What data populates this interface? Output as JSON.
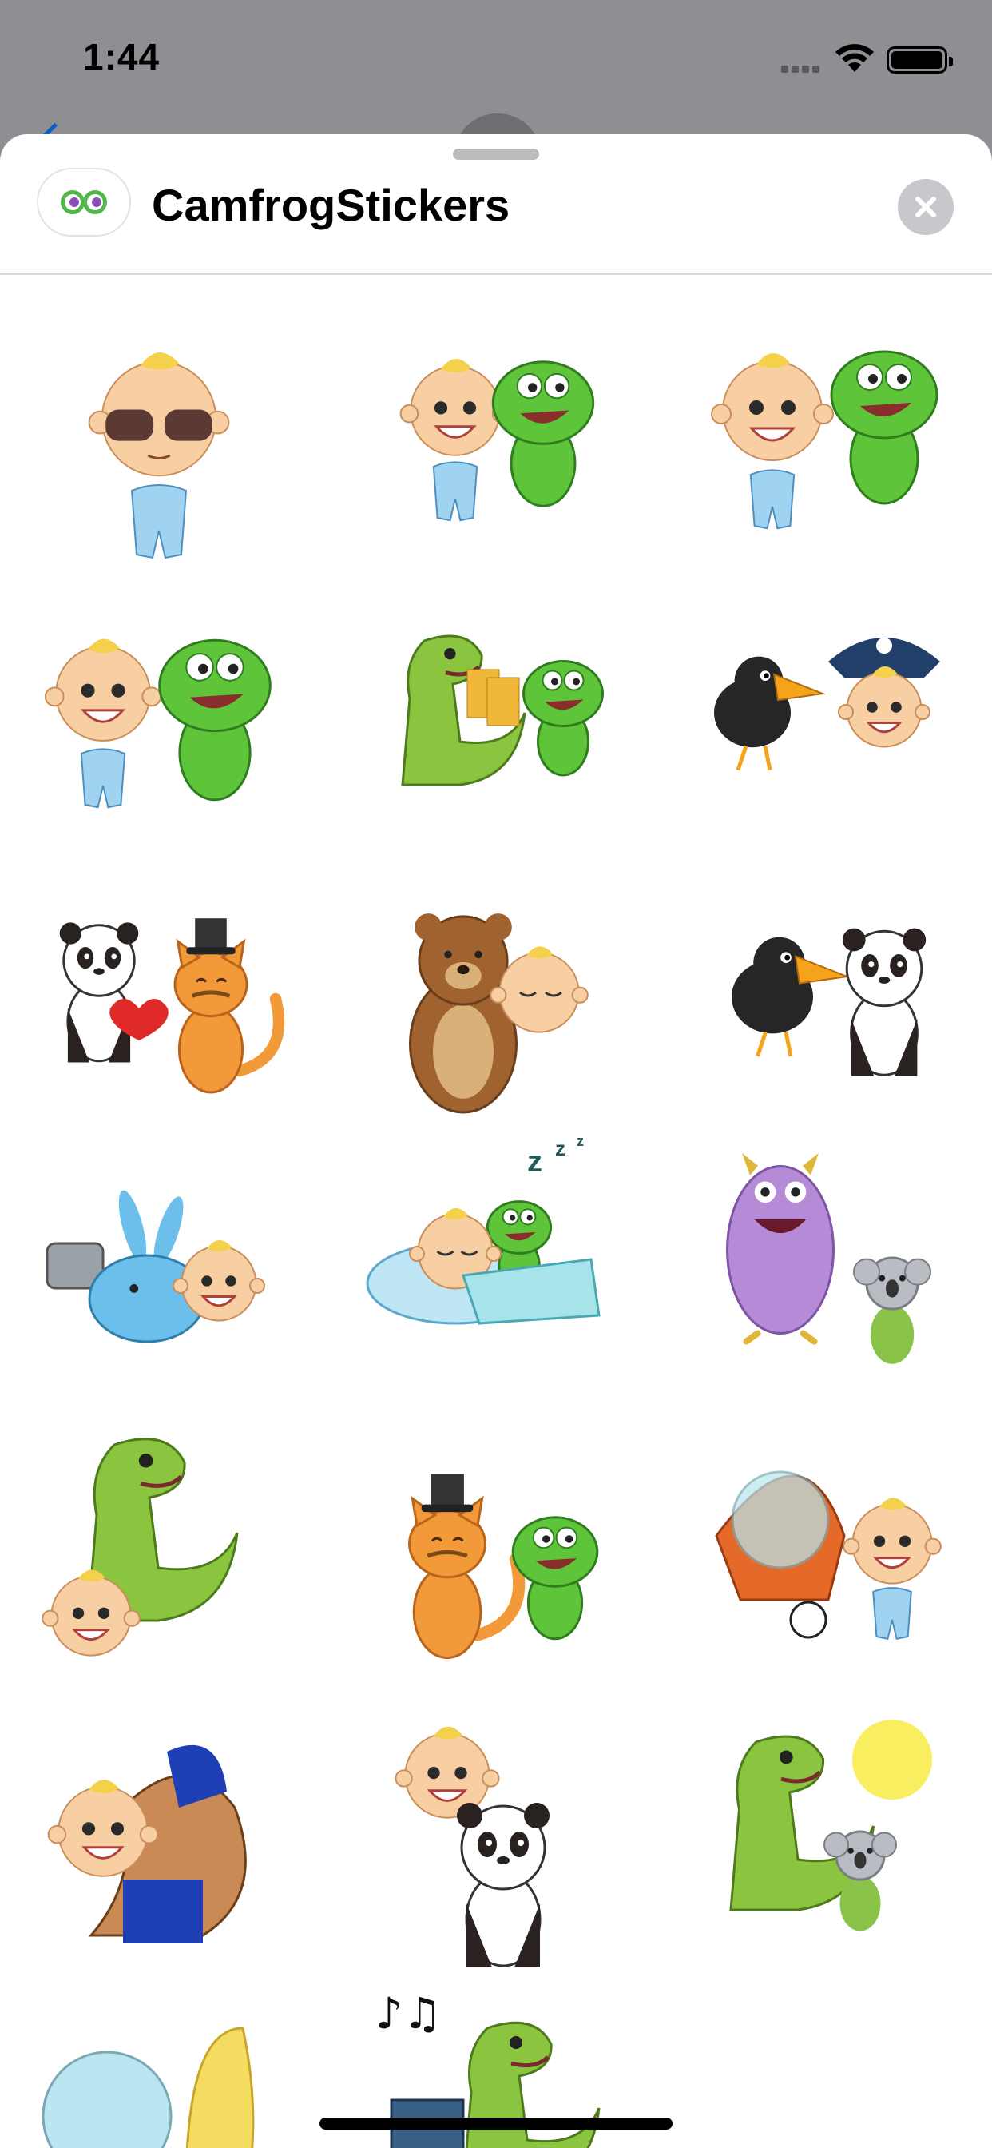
{
  "status_bar": {
    "time": "1:44"
  },
  "header": {
    "app_name": "CamfrogStickers"
  },
  "stickers": [
    {
      "name": "baby-sunglasses-sticker",
      "scene": "baby cool with sunglasses"
    },
    {
      "name": "baby-frog-highfive-sticker",
      "scene": "baby and frog high five"
    },
    {
      "name": "baby-frog-hug-sticker",
      "scene": "baby and frog hugging"
    },
    {
      "name": "baby-frog-running-sticker",
      "scene": "baby and frog running"
    },
    {
      "name": "dino-frog-cheers-sticker",
      "scene": "dinosaur and frog cheers with beer"
    },
    {
      "name": "crow-pirate-sticker",
      "scene": "crow and pirate kid"
    },
    {
      "name": "panda-cat-love-sticker",
      "scene": "panda and cat with heart"
    },
    {
      "name": "bear-baby-kiss-sticker",
      "scene": "bear and baby"
    },
    {
      "name": "crow-panda-sticker",
      "scene": "crow and panda"
    },
    {
      "name": "bunny-baby-selfie-sticker",
      "scene": "bunny and baby selfie"
    },
    {
      "name": "baby-frog-sleep-sticker",
      "scene": "baby and frog sleeping"
    },
    {
      "name": "monster-koala-sticker",
      "scene": "purple monster and koala"
    },
    {
      "name": "dino-baby-laugh-sticker",
      "scene": "dinosaur and baby laughing"
    },
    {
      "name": "cat-frog-sticker",
      "scene": "cat with top hat and frog"
    },
    {
      "name": "alien-rocket-baby-sticker",
      "scene": "alien rocket and baby with ball"
    },
    {
      "name": "wrestler-baby-sticker",
      "scene": "wrestler holding baby"
    },
    {
      "name": "baby-panda-sticker",
      "scene": "baby on panda"
    },
    {
      "name": "dino-koala-sun-sticker",
      "scene": "dinosaur, koala and sun"
    },
    {
      "name": "alien-banana-sticker",
      "scene": "alien and banana"
    },
    {
      "name": "dino-music-sticker",
      "scene": "dinosaur with music notes"
    }
  ],
  "colors": {
    "baby_skin": "#f7cfa2",
    "baby_hair": "#f5d04a",
    "baby_suit": "#9fd3f0",
    "frog": "#5ec43a",
    "frog_dark": "#2f7d1f",
    "dino": "#8bc540",
    "panda_black": "#2a2220",
    "cat": "#f29a3a",
    "bear": "#a0632f",
    "crow": "#262626",
    "beak": "#f6a31c",
    "bunny": "#6cbfea",
    "monster": "#b58ad6",
    "koala": "#b9bcc2",
    "wrestler_mask": "#1f3fb5"
  }
}
